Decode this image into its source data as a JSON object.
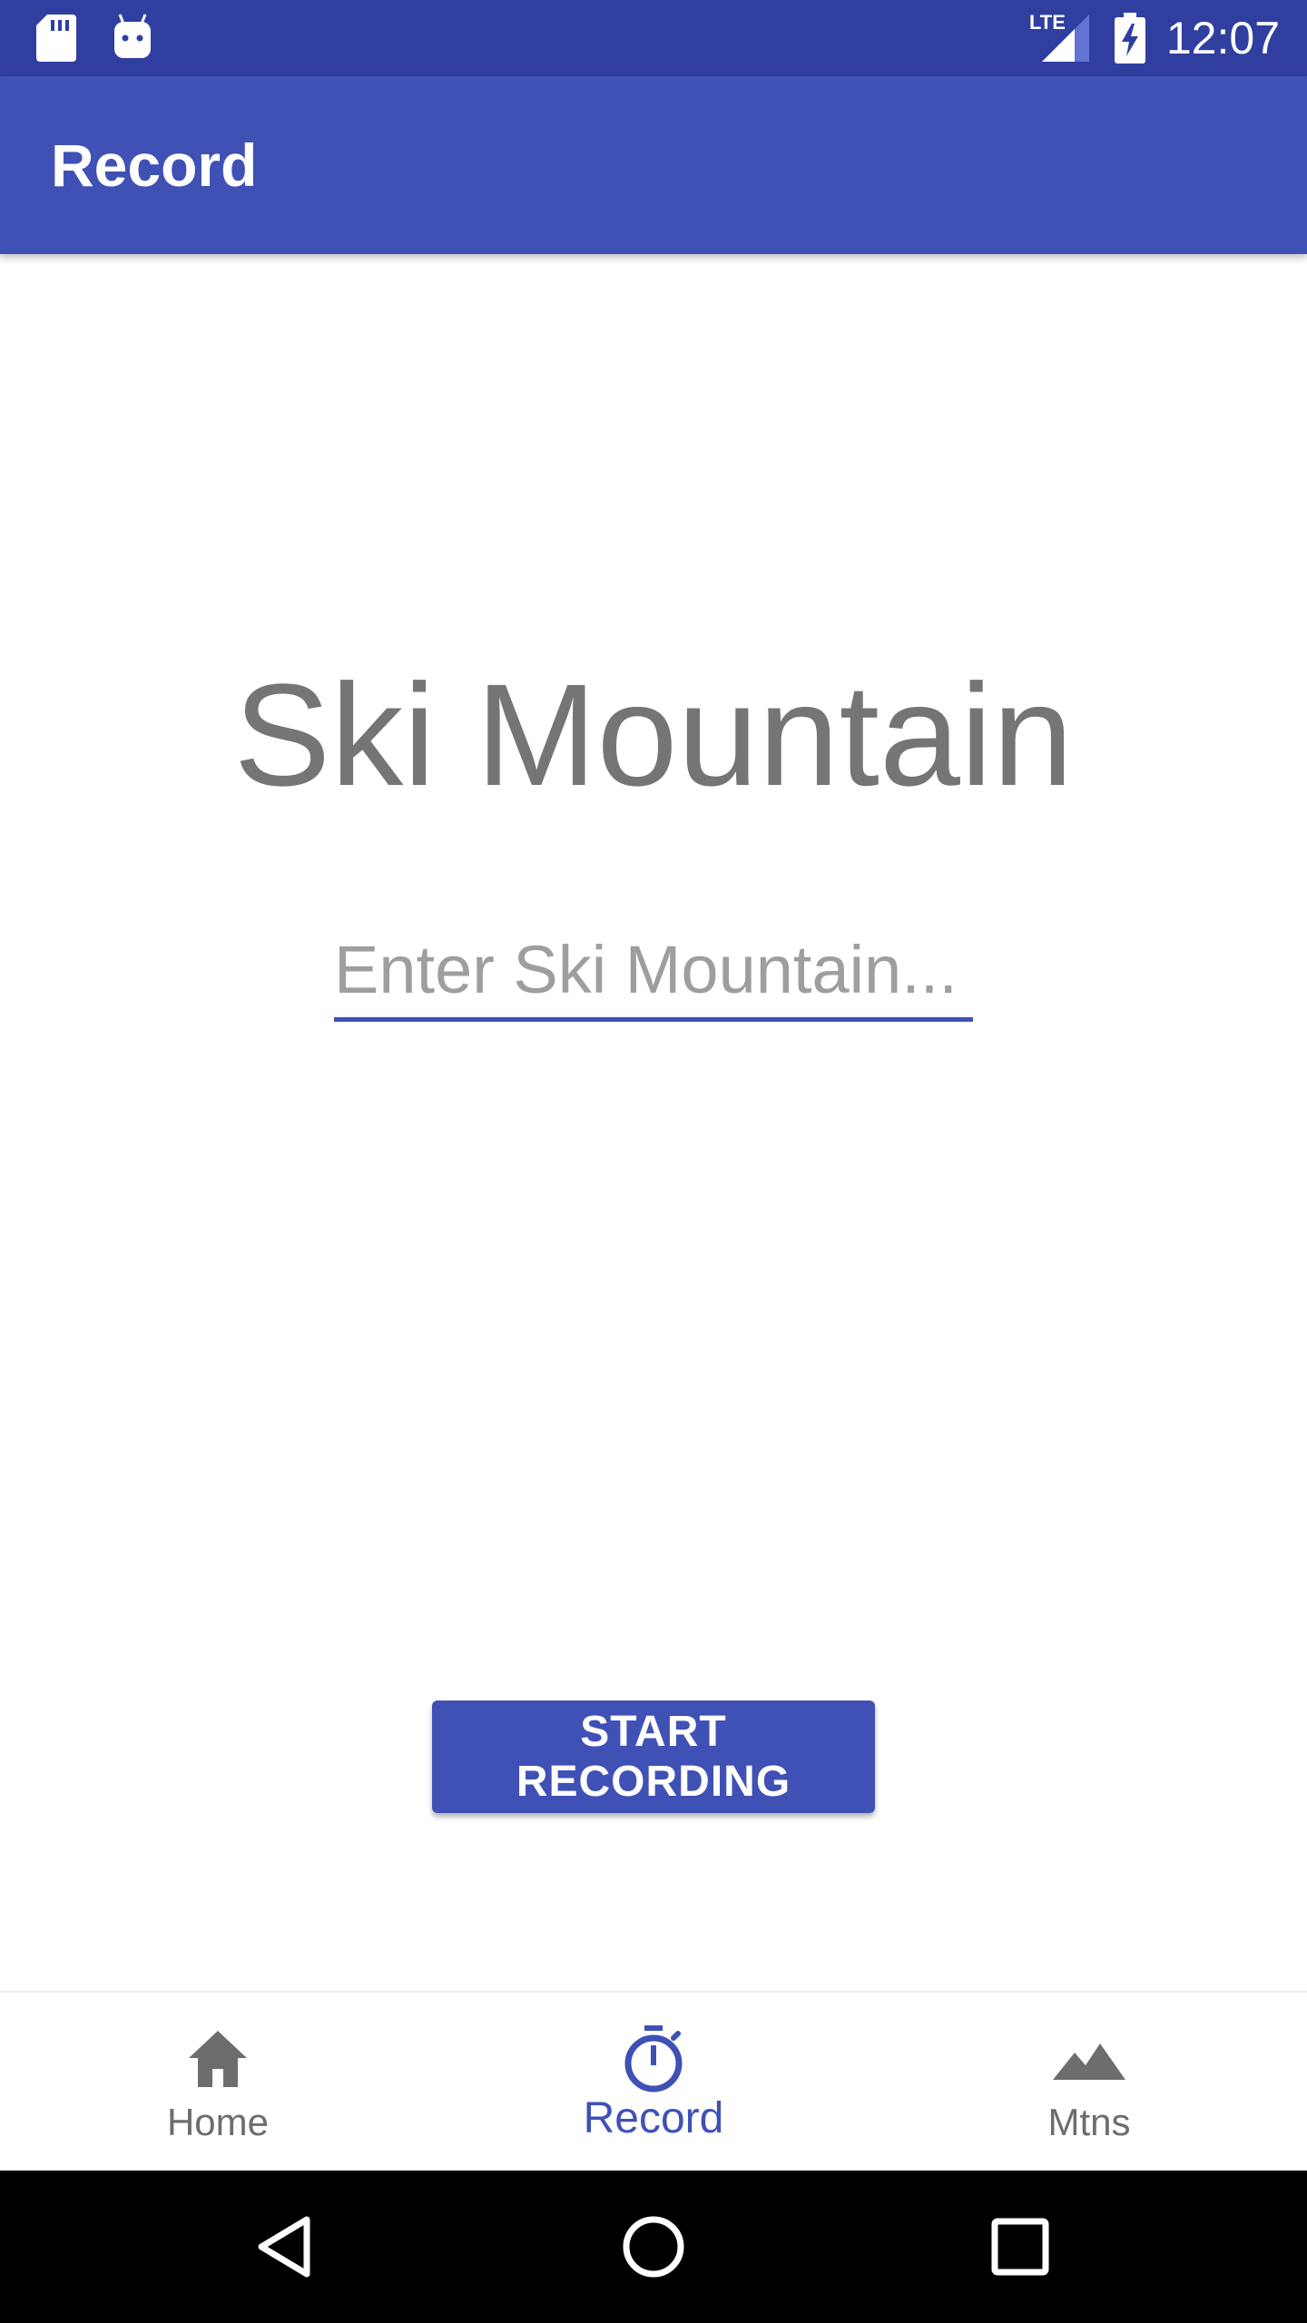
{
  "status_bar": {
    "time": "12:07",
    "network_label": "LTE",
    "icons": [
      "sd-card-icon",
      "android-icon",
      "lte-signal-icon",
      "battery-charging-icon"
    ]
  },
  "app_bar": {
    "title": "Record"
  },
  "main": {
    "heading": "Ski Mountain",
    "mountain_input": {
      "value": "",
      "placeholder": "Enter Ski Mountain..."
    },
    "start_button_label": "START RECORDING"
  },
  "bottom_nav": {
    "items": [
      {
        "label": "Home",
        "icon": "home-icon",
        "active": false
      },
      {
        "label": "Record",
        "icon": "stopwatch-icon",
        "active": true
      },
      {
        "label": "Mtns",
        "icon": "mountain-icon",
        "active": false
      }
    ]
  },
  "system_nav": {
    "buttons": [
      "back-icon",
      "home-circle-icon",
      "recents-icon"
    ]
  },
  "colors": {
    "primary": "#3f51b5",
    "primary_dark": "#303f9f",
    "heading_text": "#757575",
    "inactive_nav": "#6d6d6d"
  }
}
